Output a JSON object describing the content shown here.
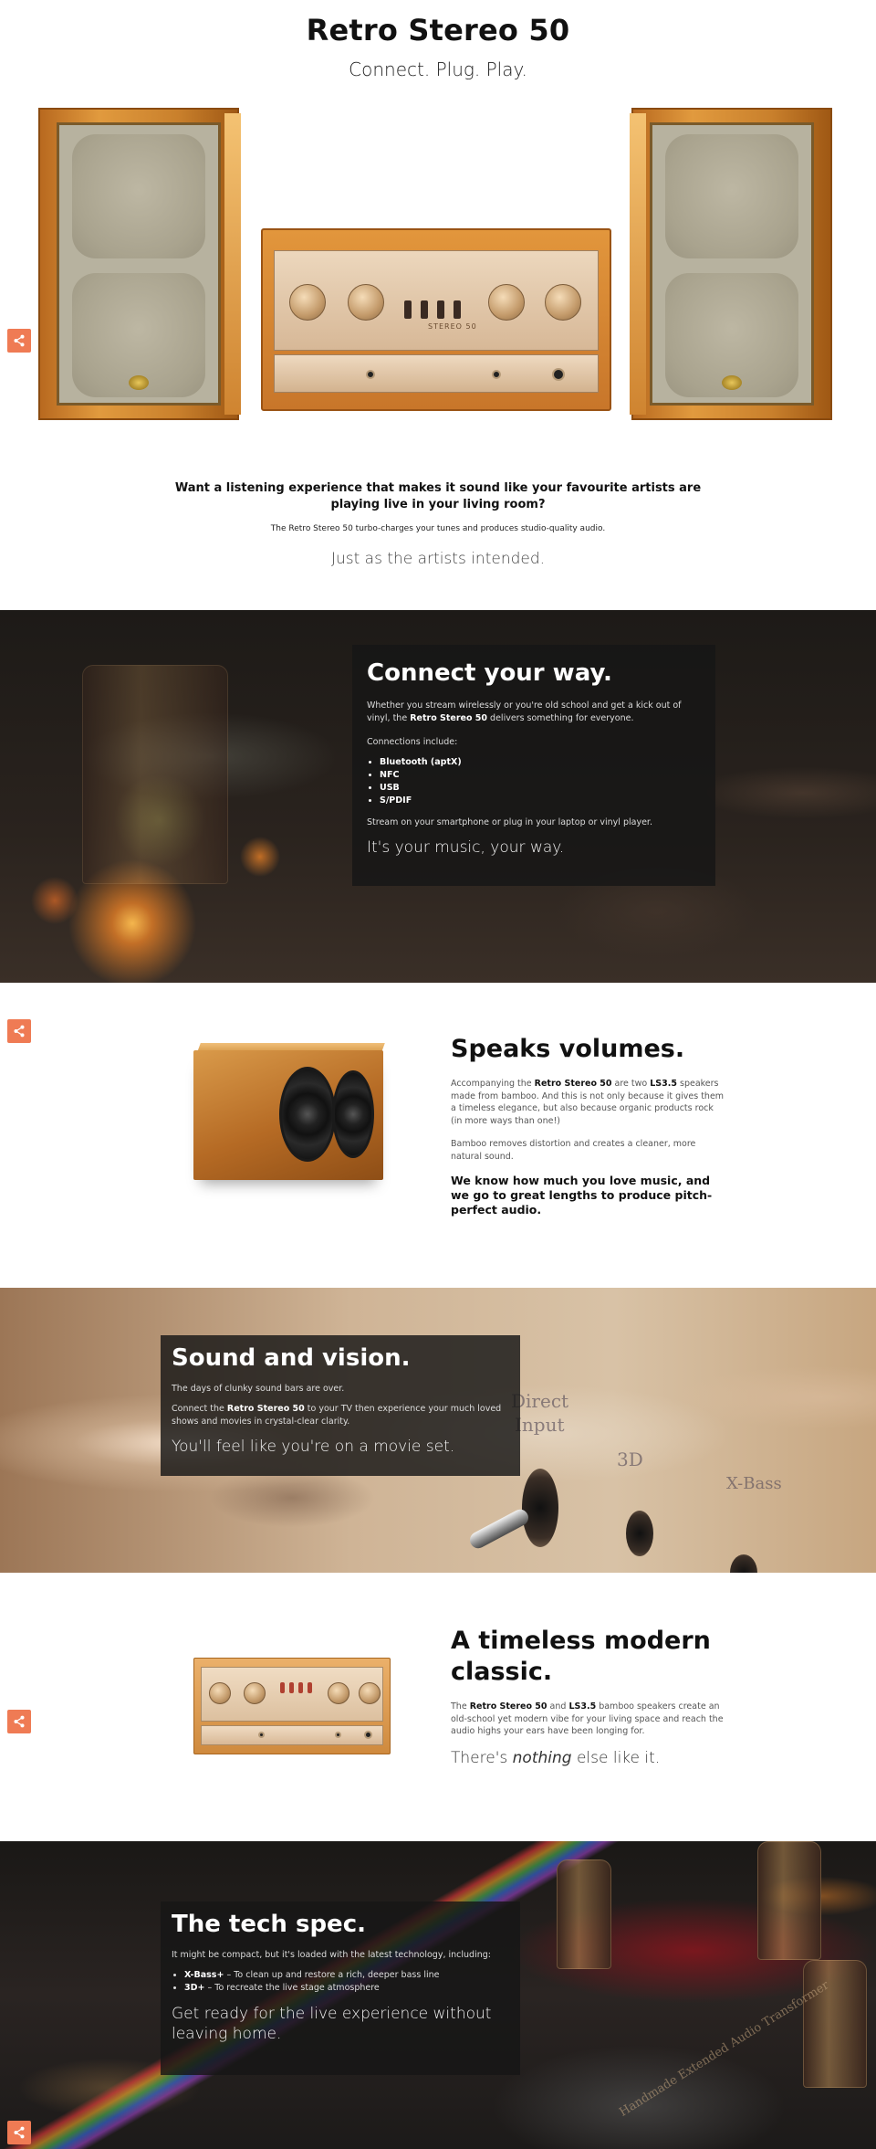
{
  "hero": {
    "title": "Retro Stereo 50",
    "subtitle": "Connect. Plug. Play.",
    "question": "Want a listening experience that makes it sound like your favourite artists are playing live in your living room?",
    "small": "The Retro Stereo 50 turbo-charges your tunes and produces studio-quality audio.",
    "quote": "Just as the artists intended.",
    "amp_label": "STEREO 50"
  },
  "connect": {
    "title": "Connect your way.",
    "intro_before": "Whether you stream wirelessly or you're old school and get a kick out of vinyl, the ",
    "intro_bold": "Retro Stereo 50",
    "intro_after": " delivers something for everyone.",
    "connections_label": "Connections include:",
    "connections": [
      "Bluetooth (aptX)",
      "NFC",
      "USB",
      "S/PDIF"
    ],
    "stream": "Stream on your smartphone or plug in your laptop or vinyl player.",
    "tagline": "It's your music, your way."
  },
  "speaks": {
    "title": "Speaks volumes.",
    "p1_before": "Accompanying the ",
    "p1_bold1": "Retro Stereo 50",
    "p1_mid": " are two ",
    "p1_bold2": "LS3.5",
    "p1_after": " speakers made from bamboo. And this is not only because it gives them a timeless elegance, but also because organic products rock (in more ways than one!)",
    "p2": "Bamboo removes distortion and creates a cleaner, more natural sound.",
    "bold": "We know how much you love music, and we go to great lengths to produce pitch-perfect audio."
  },
  "vision": {
    "title": "Sound and vision.",
    "p1": "The days of clunky sound bars are over.",
    "p2_before": "Connect the ",
    "p2_bold": "Retro Stereo 50",
    "p2_after": " to your TV then experience your much loved shows and movies in crystal-clear clarity.",
    "tagline": "You'll feel like you're on a movie set.",
    "bg_text_1": "Direct",
    "bg_text_2": "Input",
    "bg_text_3": "3D",
    "bg_text_4": "X-Bass"
  },
  "classic": {
    "title": "A timeless modern classic.",
    "p_before": "The ",
    "p_bold1": "Retro Stereo 50",
    "p_mid": " and ",
    "p_bold2": "LS3.5",
    "p_after": " bamboo speakers create an old-school yet modern vibe for your living space and reach the audio highs your ears have been longing for.",
    "big_before": "There's ",
    "big_em": "nothing",
    "big_after": " else like it."
  },
  "tech": {
    "title": "The tech spec.",
    "intro": "It might be compact, but it's loaded with the latest technology, including:",
    "items": [
      {
        "bold": "X-Bass+",
        "text": " – To clean up and restore a rich, deeper bass line"
      },
      {
        "bold": "3D+",
        "text": " – To recreate the live stage atmosphere"
      }
    ],
    "tagline": "Get ready for the live experience without leaving home.",
    "bg_text": "Handmade Extended Audio Transformer"
  },
  "share": {
    "icon": "share-icon",
    "color": "#ef7b54"
  }
}
